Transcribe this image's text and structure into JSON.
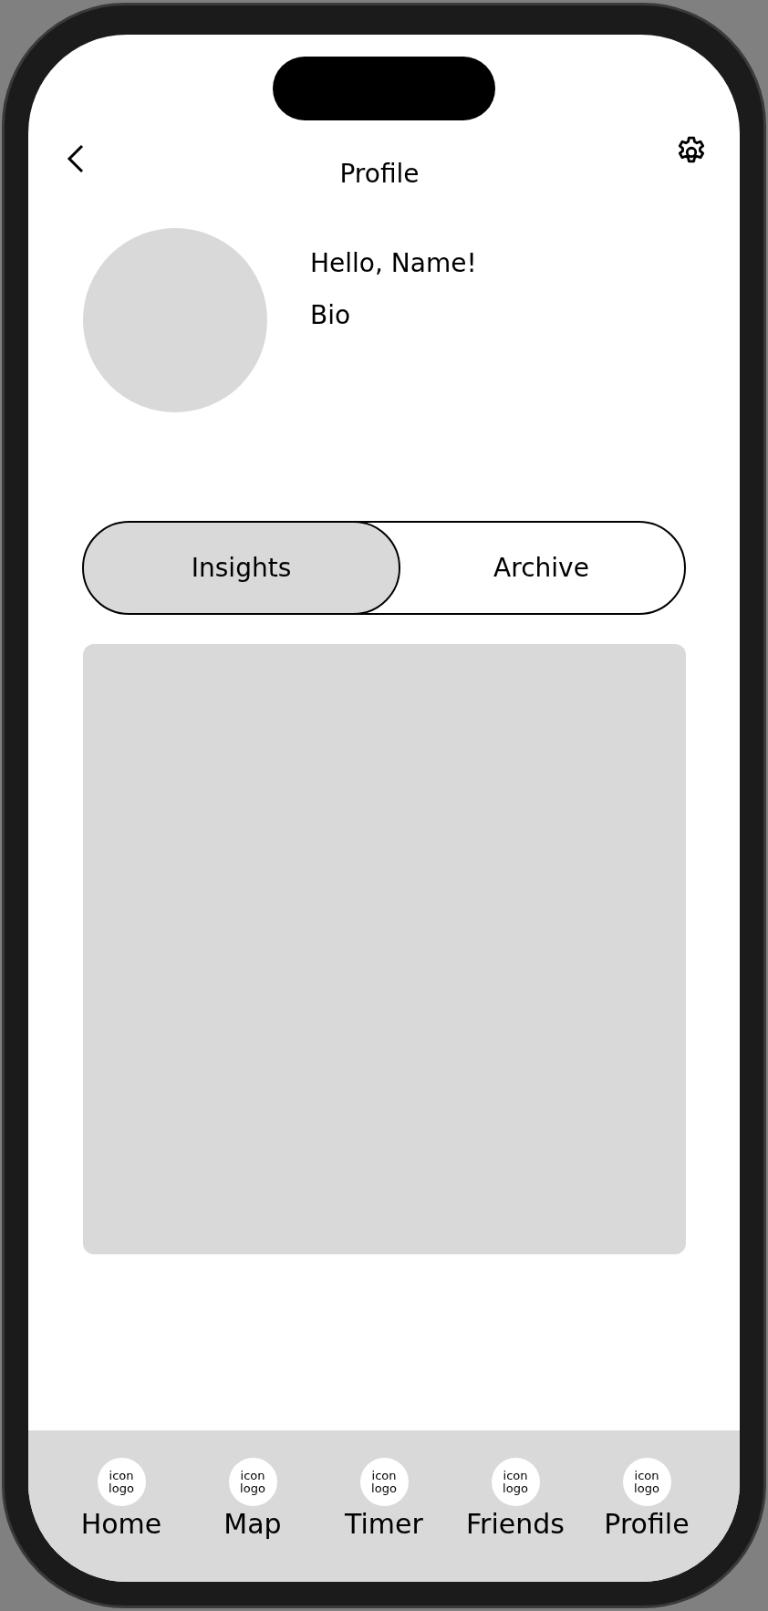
{
  "header": {
    "title": "Profile"
  },
  "profile": {
    "greeting": "Hello, Name!",
    "bio": "Bio"
  },
  "tabs": [
    {
      "label": "Insights",
      "selected": true
    },
    {
      "label": "Archive",
      "selected": false
    }
  ],
  "nav": [
    {
      "icon_text": "icon logo",
      "label": "Home"
    },
    {
      "icon_text": "icon logo",
      "label": "Map"
    },
    {
      "icon_text": "icon logo",
      "label": "Timer"
    },
    {
      "icon_text": "icon logo",
      "label": "Friends"
    },
    {
      "icon_text": "icon logo",
      "label": "Profile"
    }
  ]
}
